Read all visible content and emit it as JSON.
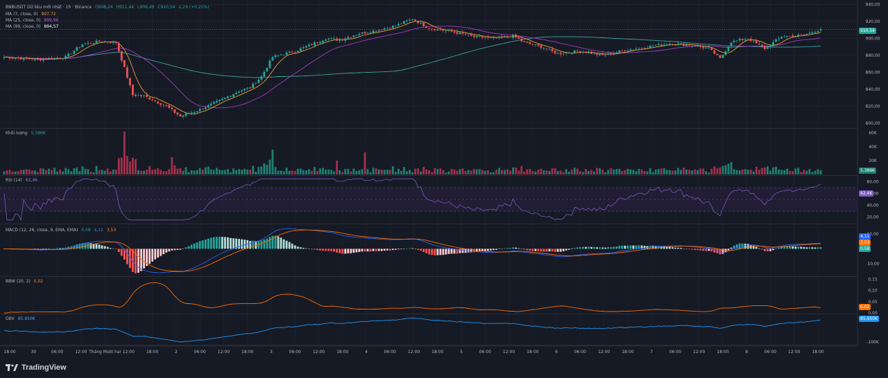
{
  "colors": {
    "background": "#161A25",
    "grid": "#232632",
    "up": "#26A69A",
    "down": "#EF5350",
    "ma7": "#F0A233",
    "ma25": "#A33BC2",
    "ma99": "#3FA59F",
    "volume_up": "#1E7F72",
    "volume_down": "#A3304A",
    "rsi_line": "#7E57C2",
    "rsi_band": "#2A2040",
    "macd_line": "#2962FF",
    "signal_line": "#FF6D00",
    "bbw_line": "#FF6D00",
    "obv_line": "#2196F3",
    "axis_text": "#B2B5BE"
  },
  "header": {
    "symbol": "BNBUSDT Dữ liệu mới nhất · 1h · Binance",
    "open": "O908,24",
    "high": "H911,44",
    "low": "L906,49",
    "close": "C910,54",
    "change": "2,29 (+0,25%)"
  },
  "ma_legend": [
    {
      "label": "MA (7, close, 0)",
      "value": "907,72"
    },
    {
      "label": "MA (25, close, 0)",
      "value": "899,96"
    },
    {
      "label": "MA (99, close, 0)",
      "value": "894,57"
    }
  ],
  "pane_labels": {
    "volume": {
      "label": "Khối lượng",
      "value": "5,386K"
    },
    "rsi": {
      "label": "RSI (14)",
      "value": "62,46"
    },
    "macd": {
      "label": "MACD (12, 26, close, 9, EMA, EMA)",
      "v1": "0,58",
      "v2": "4,11",
      "v3": "3,53"
    },
    "bbw": {
      "label": "BBW (20, 2)",
      "value": "0,02"
    },
    "obv": {
      "label": "OBV",
      "value": "85,950K"
    }
  },
  "badges": {
    "price": "910,54",
    "ma99": "894,57",
    "volume": "5,386K",
    "rsi": "62,46",
    "macd_macd": "4,11",
    "macd_signal": "3,53",
    "macd_hist": "0,58",
    "bbw": "0,02",
    "obv": "85,950K"
  },
  "axes": {
    "price_ticks": [
      "940,00",
      "920,00",
      "900,00",
      "880,00",
      "860,00",
      "840,00",
      "820,00",
      "800,00"
    ],
    "volume_ticks": [
      "60K",
      "40K",
      "20K"
    ],
    "rsi_ticks": [
      "80,00",
      "60,00",
      "40,00",
      "20,00"
    ],
    "macd_ticks": [
      "10,00",
      "-10,00"
    ],
    "bbw_ticks": [
      "0,15",
      "0,10",
      "0,05",
      "0,00"
    ],
    "obv_ticks": [
      "-100K"
    ],
    "time_ticks": [
      "18:00",
      "30",
      "06:00",
      "12:00",
      "Tháng Mười hai",
      "12:00",
      "18:00",
      "2",
      "06:00",
      "12:00",
      "18:00",
      "3",
      "06:00",
      "12:00",
      "18:00",
      "4",
      "06:00",
      "12:00",
      "18:00",
      "5",
      "06:00",
      "12:00",
      "18:00",
      "6",
      "06:00",
      "12:00",
      "18:00",
      "7",
      "06:00",
      "12:00",
      "18:00",
      "8",
      "06:00",
      "12:00",
      "18:00"
    ]
  },
  "brand": {
    "name": "TradingView"
  },
  "chart_data": {
    "type": "candlestick",
    "symbol": "BNBUSDT",
    "interval": "1h",
    "price_range": [
      795,
      942
    ],
    "anchors": [
      [
        0,
        878
      ],
      [
        12,
        875
      ],
      [
        22,
        878
      ],
      [
        28,
        893
      ],
      [
        35,
        897
      ],
      [
        40,
        895
      ],
      [
        43,
        865
      ],
      [
        46,
        833
      ],
      [
        50,
        832
      ],
      [
        58,
        820
      ],
      [
        63,
        808
      ],
      [
        70,
        816
      ],
      [
        78,
        828
      ],
      [
        84,
        838
      ],
      [
        88,
        842
      ],
      [
        92,
        855
      ],
      [
        96,
        878
      ],
      [
        104,
        885
      ],
      [
        110,
        893
      ],
      [
        115,
        900
      ],
      [
        120,
        898
      ],
      [
        126,
        905
      ],
      [
        134,
        910
      ],
      [
        140,
        915
      ],
      [
        146,
        923
      ],
      [
        152,
        912
      ],
      [
        160,
        908
      ],
      [
        168,
        902
      ],
      [
        175,
        900
      ],
      [
        182,
        903
      ],
      [
        186,
        895
      ],
      [
        192,
        890
      ],
      [
        198,
        882
      ],
      [
        206,
        885
      ],
      [
        214,
        880
      ],
      [
        222,
        886
      ],
      [
        230,
        890
      ],
      [
        238,
        894
      ],
      [
        246,
        892
      ],
      [
        252,
        888
      ],
      [
        256,
        876
      ],
      [
        260,
        896
      ],
      [
        266,
        900
      ],
      [
        272,
        888
      ],
      [
        278,
        902
      ],
      [
        286,
        904
      ],
      [
        292,
        911
      ]
    ],
    "candle_count": 293,
    "volume_range": [
      0,
      65000
    ],
    "volume_spikes": {
      "43": 62000,
      "47": 22000,
      "60": 25000,
      "96": 36000,
      "119": 20000,
      "129": 32000,
      "260": 18000
    },
    "rsi_range": [
      10,
      90
    ],
    "rsi_bands": [
      70,
      50,
      30
    ],
    "macd_range": [
      -18,
      16
    ],
    "bbw_range": [
      0,
      0.16
    ],
    "obv_range": [
      -110000,
      100000
    ]
  }
}
